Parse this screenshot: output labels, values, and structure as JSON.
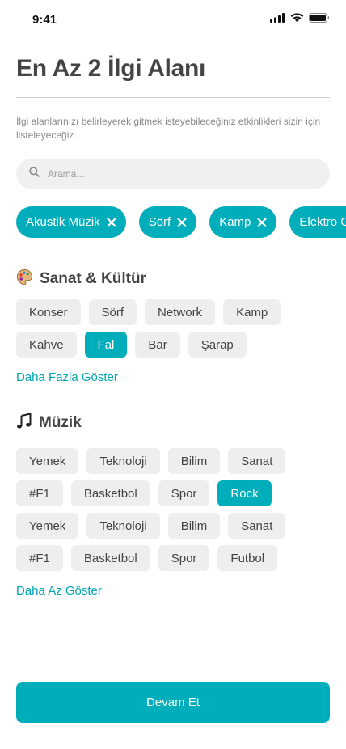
{
  "status_bar": {
    "time": "9:41"
  },
  "header": {
    "title": "En Az 2 İlgi Alanı",
    "subtitle": "İlgi alanlarınızı belirleyerek gitmek isteyebileceğiniz etkinlikleri sizin için listeleyeceğiz."
  },
  "search": {
    "placeholder": "Arama..."
  },
  "selected": [
    "Akustik Müzik",
    "Sörf",
    "Kamp",
    "Elektro Gitar"
  ],
  "sections": [
    {
      "title": "Sanat & Kültür",
      "icon": "palette-icon",
      "tags": [
        {
          "label": "Konser",
          "active": false
        },
        {
          "label": "Sörf",
          "active": false
        },
        {
          "label": "Network",
          "active": false
        },
        {
          "label": "Kamp",
          "active": false
        },
        {
          "label": "Kahve",
          "active": false
        },
        {
          "label": "Fal",
          "active": true
        },
        {
          "label": "Bar",
          "active": false
        },
        {
          "label": "Şarap",
          "active": false
        }
      ],
      "link": "Daha Fazla Göster"
    },
    {
      "title": "Müzik",
      "icon": "music-note-icon",
      "tags": [
        {
          "label": "Yemek",
          "active": false
        },
        {
          "label": "Teknoloji",
          "active": false
        },
        {
          "label": "Bilim",
          "active": false
        },
        {
          "label": "Sanat",
          "active": false
        },
        {
          "label": "#F1",
          "active": false
        },
        {
          "label": "Basketbol",
          "active": false
        },
        {
          "label": "Spor",
          "active": false
        },
        {
          "label": "Rock",
          "active": true
        },
        {
          "label": "Yemek",
          "active": false
        },
        {
          "label": "Teknoloji",
          "active": false
        },
        {
          "label": "Bilim",
          "active": false
        },
        {
          "label": "Sanat",
          "active": false
        },
        {
          "label": "#F1",
          "active": false
        },
        {
          "label": "Basketbol",
          "active": false
        },
        {
          "label": "Spor",
          "active": false
        },
        {
          "label": "Futbol",
          "active": false
        }
      ],
      "link": "Daha Az Göster"
    }
  ],
  "cta": {
    "label": "Devam Et"
  },
  "colors": {
    "accent": "#00adbb",
    "chip_bg": "#eeeeee",
    "text": "#444444"
  }
}
